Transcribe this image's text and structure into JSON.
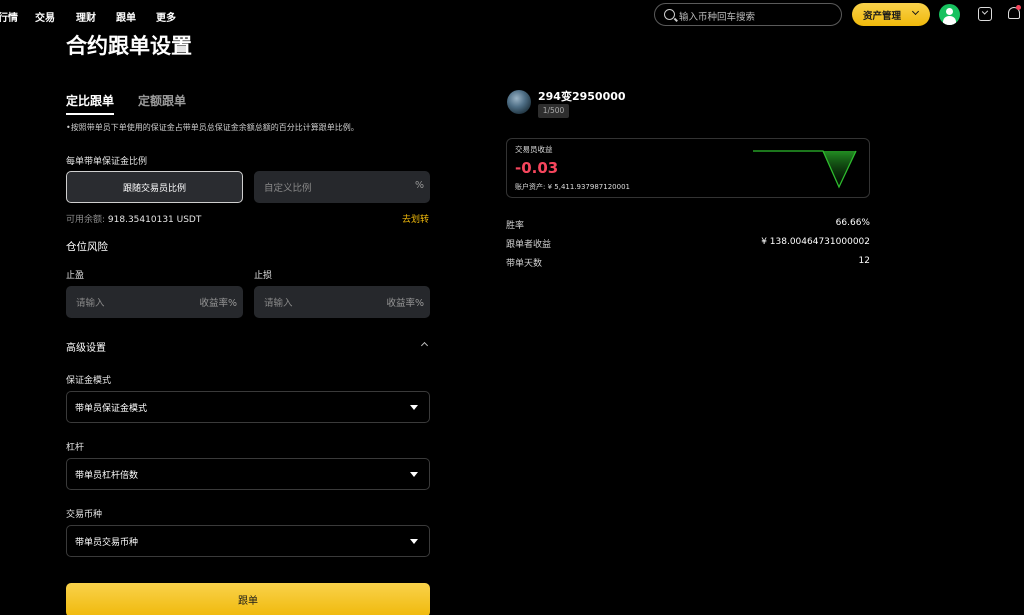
{
  "nav": {
    "items": [
      "行情",
      "交易",
      "理财",
      "跟单",
      "更多"
    ],
    "search_placeholder": "输入币种回车搜索",
    "asset_button": "资产管理"
  },
  "page": {
    "title": "合约跟单设置",
    "tabs": [
      "定比跟单",
      "定额跟单"
    ],
    "description": "•按照带单员下单使用的保证金占带单员总保证金余额总额的百分比计算跟单比例。"
  },
  "ratio": {
    "label": "每单带单保证金比例",
    "follow_trader_button": "跟随交易员比例",
    "custom_placeholder": "自定义比例",
    "custom_suffix": "%",
    "available_label": "可用余额:",
    "available_value": "918.35410131 USDT",
    "transfer_link": "去划转"
  },
  "risk": {
    "title": "仓位风险",
    "take_profit_label": "止盈",
    "stop_loss_label": "止损",
    "placeholder": "请输入",
    "suffix": "收益率%"
  },
  "advanced": {
    "title": "高级设置",
    "margin_mode_label": "保证金模式",
    "margin_mode_value": "带单员保证金模式",
    "leverage_label": "杠杆",
    "leverage_value": "带单员杠杆倍数",
    "coin_label": "交易币种",
    "coin_value": "带单员交易币种"
  },
  "follow_button": "跟单",
  "trader": {
    "name": "294变2950000",
    "badge": "1/500",
    "pnl_label": "交易员收益",
    "pnl_value": "-0.03",
    "pnl_color": "#f6465d",
    "asset_text": "账户资产: ¥ 5,411.937987120001",
    "stats": [
      {
        "label": "胜率",
        "value": "66.66%"
      },
      {
        "label": "跟单者收益",
        "value": "¥ 138.00464731000002"
      },
      {
        "label": "带单天数",
        "value": "12"
      }
    ]
  },
  "colors": {
    "accent": "#f0b90b",
    "link": "#f0b90b",
    "loss": "#f6465d",
    "chart_green": "#2ebd2e"
  }
}
